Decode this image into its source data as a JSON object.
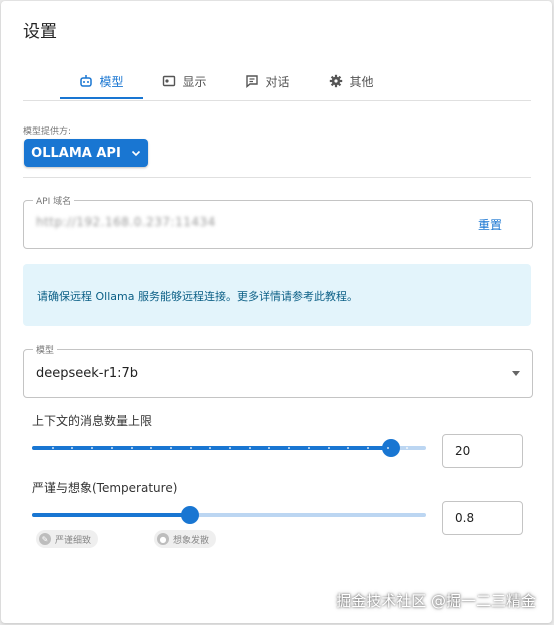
{
  "dialog": {
    "title": "设置"
  },
  "tabs": [
    {
      "label": "模型",
      "icon": "robot-icon",
      "active": true
    },
    {
      "label": "显示",
      "icon": "display-icon",
      "active": false
    },
    {
      "label": "对话",
      "icon": "chat-icon",
      "active": false
    },
    {
      "label": "其他",
      "icon": "gear-icon",
      "active": false
    }
  ],
  "provider": {
    "label": "模型提供方:",
    "value": "OLLAMA API"
  },
  "api_host": {
    "legend": "API 域名",
    "value": "http://192.168.0.237:11434",
    "reset_label": "重置"
  },
  "info": {
    "text": "请确保远程 Ollama 服务能够远程连接。更多详情请参考此教程。"
  },
  "model": {
    "legend": "模型",
    "value": "deepseek-r1:7b"
  },
  "context_limit": {
    "label": "上下文的消息数量上限",
    "value": "20",
    "fraction": 0.91,
    "ticks": 20
  },
  "temperature": {
    "label": "严谨与想象(Temperature)",
    "value": "0.8",
    "fraction": 0.4,
    "chip_left": "严谨细致",
    "chip_right": "想象发散"
  },
  "watermark": "掘金技术社区 @掘一二三精金",
  "colors": {
    "accent": "#1976d2",
    "info_bg": "#e3f4fb",
    "info_text": "#0b5f86"
  }
}
